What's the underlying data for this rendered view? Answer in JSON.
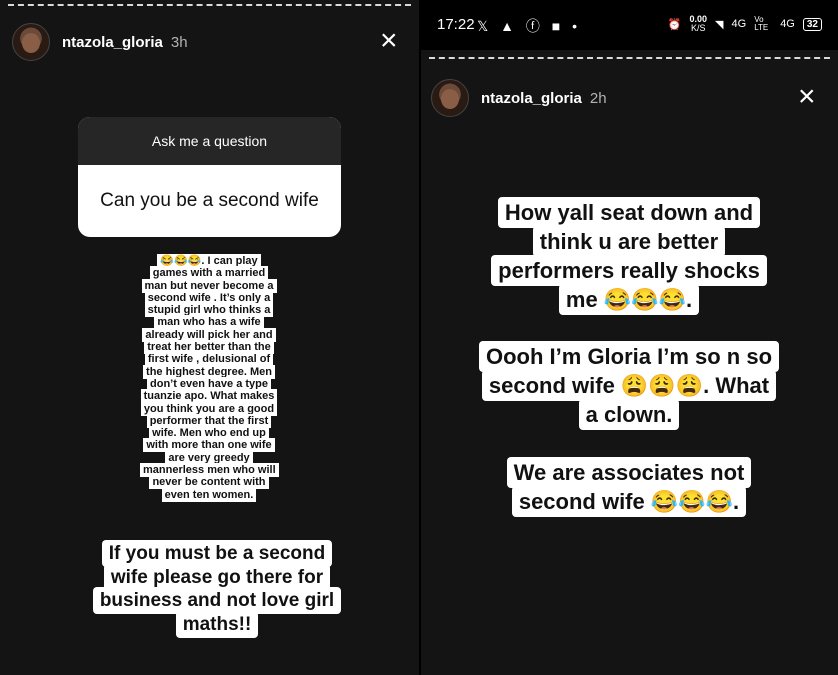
{
  "left": {
    "username": "ntazola_gloria",
    "time": "3h",
    "close_icon": "×",
    "question_header": "Ask me a question",
    "question_text": "Can you be a second wife",
    "reply_paragraph": "😂😂😂. I can play games with a married man but never become a second wife . It’s only a stupid girl who thinks a man who has a wife already will pick her and treat her better than the first wife , delusional of the highest degree. Men don’t even have a type tuanzie apo. What makes you think you are a good performer that the first wife. Men who end up with more than one wife are very greedy mannerless men who will never be content with even ten women.",
    "closing_text": "If you must be a second wife please go there for business and not love girl maths!!"
  },
  "right": {
    "status": {
      "time": "17:22",
      "left_icons": "𝕏 ▲ ⓕ ■ •",
      "speed_top": "0.00",
      "speed_unit": "K/S",
      "net1": "4G",
      "volte": "Vo LTE",
      "net2": "4G",
      "battery": "32"
    },
    "username": "ntazola_gloria",
    "time": "2h",
    "close_icon": "×",
    "text1": "How yall seat down and think u are better performers really shocks me 😂😂😂.",
    "text2": "Oooh I’m Gloria I’m so n so second wife 😩😩😩. What a clown.",
    "text3": "We are associates not second wife 😂😂😂."
  }
}
